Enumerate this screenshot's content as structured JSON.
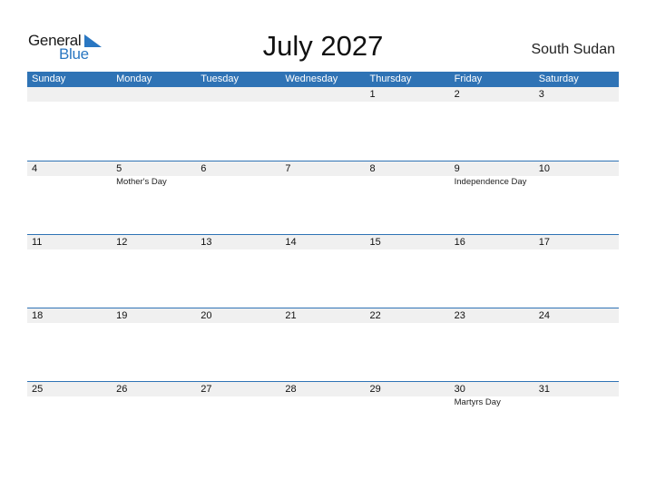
{
  "logo": {
    "text_top": "General",
    "text_bottom": "Blue",
    "icon": "triangle-flag-icon",
    "accent": "#2a77c2"
  },
  "header": {
    "title": "July 2027",
    "country": "South Sudan"
  },
  "colors": {
    "header_bg": "#2f73b5",
    "date_strip_bg": "#f0f0f0"
  },
  "weekdays": [
    "Sunday",
    "Monday",
    "Tuesday",
    "Wednesday",
    "Thursday",
    "Friday",
    "Saturday"
  ],
  "weeks": [
    {
      "days": [
        "",
        "",
        "",
        "",
        "1",
        "2",
        "3"
      ],
      "events": [
        "",
        "",
        "",
        "",
        "",
        "",
        ""
      ]
    },
    {
      "days": [
        "4",
        "5",
        "6",
        "7",
        "8",
        "9",
        "10"
      ],
      "events": [
        "",
        "Mother's Day",
        "",
        "",
        "",
        "Independence Day",
        ""
      ]
    },
    {
      "days": [
        "11",
        "12",
        "13",
        "14",
        "15",
        "16",
        "17"
      ],
      "events": [
        "",
        "",
        "",
        "",
        "",
        "",
        ""
      ]
    },
    {
      "days": [
        "18",
        "19",
        "20",
        "21",
        "22",
        "23",
        "24"
      ],
      "events": [
        "",
        "",
        "",
        "",
        "",
        "",
        ""
      ]
    },
    {
      "days": [
        "25",
        "26",
        "27",
        "28",
        "29",
        "30",
        "31"
      ],
      "events": [
        "",
        "",
        "",
        "",
        "",
        "Martyrs Day",
        ""
      ]
    }
  ]
}
